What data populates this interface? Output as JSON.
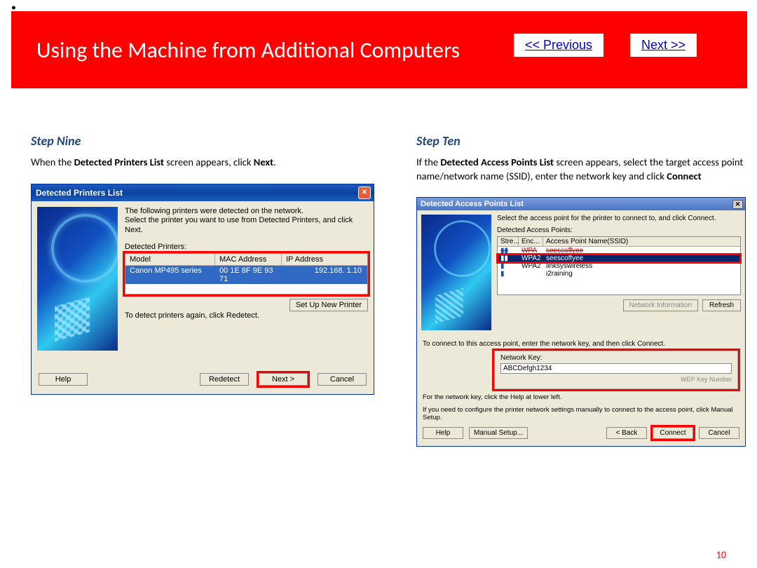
{
  "bullet": "•",
  "banner": {
    "title": "Using the Machine from Additional Computers",
    "prev": "<< Previous",
    "next": "Next >>"
  },
  "stepNine": {
    "label": "Step Nine",
    "desc_pre": "When the ",
    "desc_b1": "Detected Printers List",
    "desc_mid": " screen appears, click ",
    "desc_b2": "Next",
    "desc_end": "."
  },
  "stepTen": {
    "label": "Step Ten",
    "desc_pre": "If the ",
    "desc_b1": "Detected Access Points List",
    "desc_mid": " screen appears, select the target access point name/network name (SSID), enter the network key and click ",
    "desc_b2": "Connect",
    "desc_end": ""
  },
  "dlg1": {
    "title": "Detected Printers List",
    "instr": "The following printers were detected on the network.\nSelect the printer you want to use from Detected Printers, and click Next.",
    "listLabel": "Detected Printers:",
    "hdr": {
      "model": "Model",
      "mac": "MAC Address",
      "ip": "IP Address"
    },
    "row": {
      "model": "Canon MP495 series",
      "mac": "00 1E 8F 9E 93 71",
      "ip": "192.168.  1.10"
    },
    "setupNew": "Set Up New Printer",
    "redetectNote": "To detect printers again, click Redetect.",
    "help": "Help",
    "redetect": "Redetect",
    "next": "Next >",
    "cancel": "Cancel"
  },
  "dlg2": {
    "title": "Detected Access Points List",
    "instr": "Select the access point for the printer to connect to, and click Connect.",
    "listLabel": "Detected Access Points:",
    "hdr": {
      "str": "Stre...",
      "enc": "Enc...",
      "ssid": "Access Point Name(SSID)"
    },
    "rows": [
      {
        "icon": "▮▮",
        "enc": "WPA",
        "ssid": "seescoffyee",
        "struck": true,
        "sel": false,
        "outline": false
      },
      {
        "icon": "▮▮",
        "enc": "WPA2",
        "ssid": "seescoffyee",
        "struck": false,
        "sel": true,
        "outline": true
      },
      {
        "icon": "▮",
        "enc": "WPA2",
        "ssid": "linksyswireless",
        "struck": false,
        "sel": false,
        "outline": false
      },
      {
        "icon": "▮",
        "enc": "",
        "ssid": "i2raining",
        "struck": false,
        "sel": false,
        "outline": false
      }
    ],
    "netInfo": "Network Information",
    "refresh": "Refresh",
    "connectInstr": "To connect to this access point, enter the network key, and then click Connect.",
    "netKeyLabel": "Network Key:",
    "netKeyValue": "ABCDefgh1234",
    "wepLabel": "WEP Key Number",
    "helpNote1": "For the network key, click the Help at lower left.",
    "helpNote2": "If you need to configure the printer network settings manually to connect to the access point, click Manual Setup.",
    "help": "Help",
    "manual": "Manual Setup...",
    "back": "< Back",
    "connect": "Connect",
    "cancel": "Cancel"
  },
  "pageNum": "10"
}
